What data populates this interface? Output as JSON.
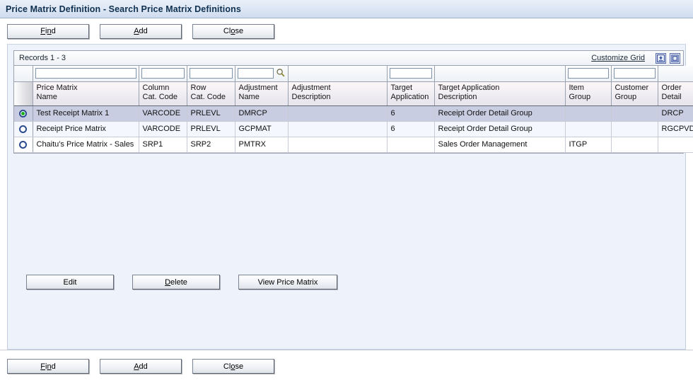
{
  "window": {
    "title": "Price Matrix Definition - Search Price Matrix Definitions"
  },
  "toolbar_top": {
    "find_label": "Find",
    "add_label": "Add",
    "close_label": "Close"
  },
  "toolbar_bottom": {
    "find_label": "Find",
    "add_label": "Add",
    "close_label": "Close"
  },
  "grid": {
    "records_label": "Records 1 - 3",
    "customize_link": "Customize Grid",
    "export_icon": "export-icon",
    "maximize_icon": "maximize-icon",
    "search_icon": "search-icon",
    "columns": [
      {
        "line1": "Price Matrix",
        "line2": "Name"
      },
      {
        "line1": "Column",
        "line2": "Cat. Code"
      },
      {
        "line1": "Row",
        "line2": "Cat. Code"
      },
      {
        "line1": "Adjustment",
        "line2": "Name"
      },
      {
        "line1": "Adjustment",
        "line2": "Description"
      },
      {
        "line1": "Target",
        "line2": "Application"
      },
      {
        "line1": "Target Application",
        "line2": "Description"
      },
      {
        "line1": "Item",
        "line2": "Group"
      },
      {
        "line1": "Customer",
        "line2": "Group"
      },
      {
        "line1": "Order",
        "line2": "Detail"
      }
    ],
    "filters": {
      "price_matrix_name": "",
      "column_cat_code": "",
      "row_cat_code": "",
      "adjustment_name": "",
      "target_application": "",
      "item_group": "",
      "customer_group": ""
    },
    "rows": [
      {
        "selected": true,
        "price_matrix_name": "Test Receipt Matrix 1",
        "column_cat_code": "VARCODE",
        "row_cat_code": "PRLEVL",
        "adjustment_name": "DMRCP",
        "adjustment_description": "",
        "target_application": "6",
        "target_application_description": "Receipt Order Detail Group",
        "item_group": "",
        "customer_group": "",
        "order_detail": "DRCP"
      },
      {
        "selected": false,
        "price_matrix_name": "Receipt Price Matrix",
        "column_cat_code": "VARCODE",
        "row_cat_code": "PRLEVL",
        "adjustment_name": "GCPMAT",
        "adjustment_description": "",
        "target_application": "6",
        "target_application_description": "Receipt Order Detail Group",
        "item_group": "",
        "customer_group": "",
        "order_detail": "RGCPVDL"
      },
      {
        "selected": false,
        "price_matrix_name": "Chaitu's Price Matrix - Sales",
        "column_cat_code": "SRP1",
        "row_cat_code": "SRP2",
        "adjustment_name": "PMTRX",
        "adjustment_description": "",
        "target_application": "",
        "target_application_description": "Sales Order Management",
        "item_group": "ITGP",
        "customer_group": "",
        "order_detail": ""
      }
    ]
  },
  "actions": {
    "edit_label": "Edit",
    "delete_label": "Delete",
    "view_label": "View Price Matrix"
  },
  "colors": {
    "title_text": "#103050",
    "panel_bg": "#eef2fb",
    "selected_row": "#c8cde1",
    "radio_ring": "#2b4a90",
    "radio_dot": "#19b119"
  }
}
